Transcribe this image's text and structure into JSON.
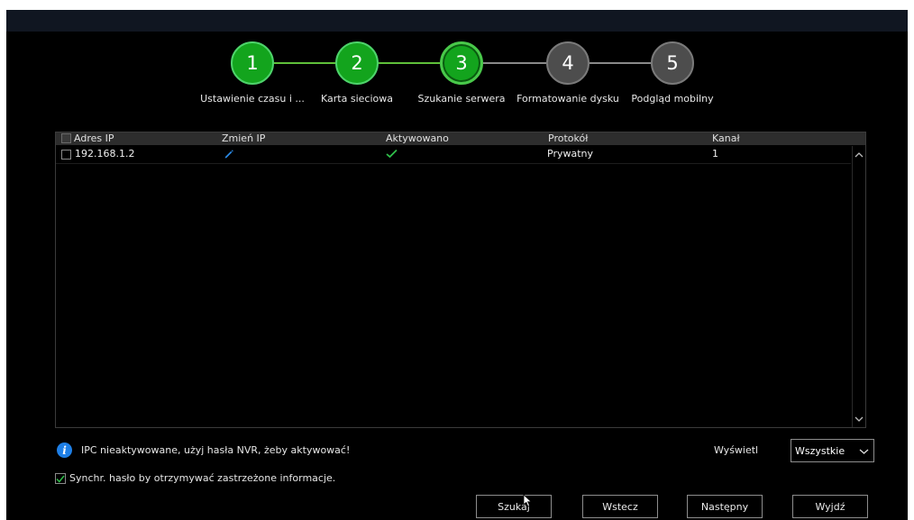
{
  "wizard": {
    "steps": [
      {
        "number": "1",
        "label": "Ustawienie czasu i ...",
        "state": "done"
      },
      {
        "number": "2",
        "label": "Karta sieciowa",
        "state": "done"
      },
      {
        "number": "3",
        "label": "Szukanie serwera",
        "state": "current"
      },
      {
        "number": "4",
        "label": "Formatowanie dysku",
        "state": "pending"
      },
      {
        "number": "5",
        "label": "Podgląd mobilny",
        "state": "pending"
      }
    ]
  },
  "table": {
    "columns": [
      "Adres IP",
      "Zmień IP",
      "Aktywowano",
      "Protokół",
      "Kanał"
    ],
    "rows": [
      {
        "ip": "192.168.1.2",
        "change_ip_icon": "pencil-icon",
        "activated_icon": "checkmark-icon",
        "protocol": "Prywatny",
        "channel": "1"
      }
    ]
  },
  "info": {
    "icon": "info-icon",
    "text": "IPC nieaktywowane, użyj hasła NVR, żeby aktywować!"
  },
  "display_filter": {
    "label": "Wyświetl",
    "selected": "Wszystkie"
  },
  "sync_password": {
    "checked": true,
    "label": "Synchr. hasło by otrzymywać zastrzeżone informacje."
  },
  "buttons": {
    "search": "Szukaj",
    "back": "Wstecz",
    "next": "Następny",
    "exit": "Wyjdź"
  },
  "colors": {
    "step_done": "#13a41d",
    "step_pending": "#4d4d4d",
    "info_blue": "#1e7fe6",
    "check_green": "#2fbf4a",
    "pencil_blue": "#2b8be8"
  }
}
